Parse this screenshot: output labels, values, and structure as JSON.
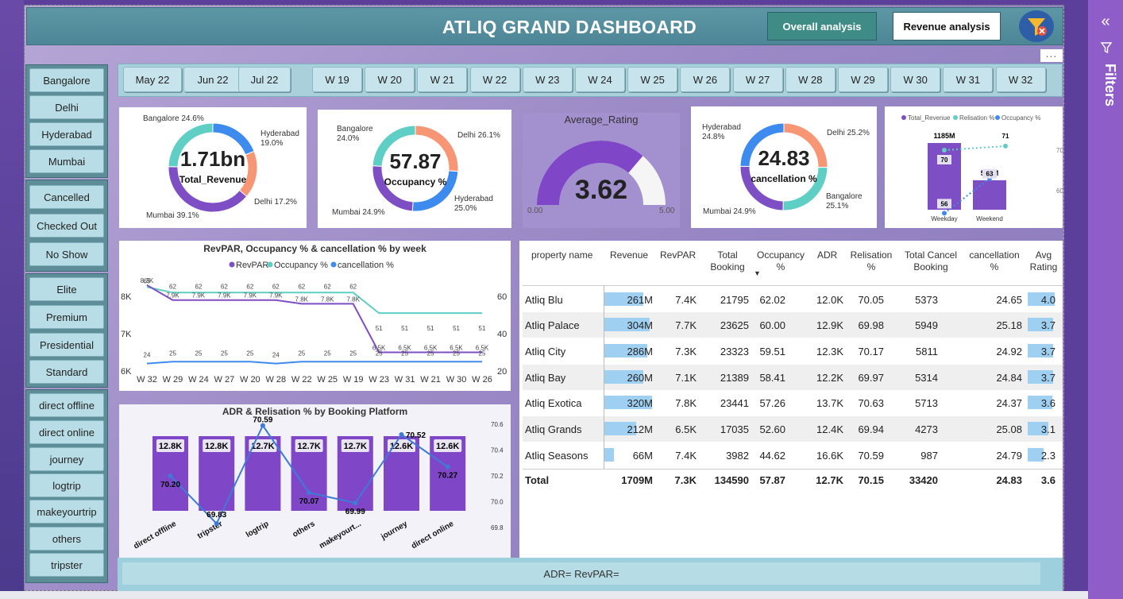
{
  "header": {
    "title": "ATLIQ GRAND DASHBOARD",
    "btn_overall": "Overall analysis",
    "btn_revenue": "Revenue analysis"
  },
  "filters_pane": {
    "label": "Filters",
    "chevron": "«"
  },
  "more_dots": "...",
  "slicers": {
    "cities": [
      "Bangalore",
      "Delhi",
      "Hyderabad",
      "Mumbai"
    ],
    "status": [
      "Cancelled",
      "Checked Out",
      "No Show"
    ],
    "room_class": [
      "Elite",
      "Premium",
      "Presidential",
      "Standard"
    ],
    "platforms": [
      "direct offline",
      "direct online",
      "journey",
      "logtrip",
      "makeyourtrip",
      "others",
      "tripster"
    ],
    "months": [
      "May 22",
      "Jun 22",
      "Jul 22"
    ],
    "weeks": [
      "W 19",
      "W 20",
      "W 21",
      "W 22",
      "W 23",
      "W 24",
      "W 25",
      "W 26",
      "W 27",
      "W 28",
      "W 29",
      "W 30",
      "W 31",
      "W 32"
    ]
  },
  "kpi_revenue": {
    "value": "1.71bn",
    "label": "Total_Revenue",
    "segments": [
      {
        "name": "Bangalore",
        "pct": 24.6,
        "color": "#5fcfc5",
        "text": "Bangalore 24.6%"
      },
      {
        "name": "Hyderabad",
        "pct": 19.0,
        "color": "#3e8bef",
        "text": "Hyderabad 19.0%"
      },
      {
        "name": "Delhi",
        "pct": 17.2,
        "color": "#f79675",
        "text": "Delhi 17.2%"
      },
      {
        "name": "Mumbai",
        "pct": 39.1,
        "color": "#7e4fc4",
        "text": "Mumbai 39.1%"
      }
    ]
  },
  "kpi_occupancy": {
    "value": "57.87",
    "label": "Occupancy %",
    "segments": [
      {
        "name": "Delhi",
        "pct": 26.1,
        "color": "#f79675",
        "text": "Delhi 26.1%"
      },
      {
        "name": "Hyderabad",
        "pct": 25.0,
        "color": "#3e8bef",
        "text": "Hyderabad 25.0%"
      },
      {
        "name": "Mumbai",
        "pct": 24.9,
        "color": "#7e4fc4",
        "text": "Mumbai 24.9%"
      },
      {
        "name": "Bangalore",
        "pct": 24.0,
        "color": "#5fcfc5",
        "text": "Bangalore 24.0%"
      }
    ]
  },
  "kpi_rating": {
    "title": "Average_Rating",
    "value": "3.62",
    "min": "0.00",
    "max": "5.00",
    "rating": 3.62,
    "scale_max": 5
  },
  "kpi_cancellation": {
    "value": "24.83",
    "label": "cancellation %",
    "segments": [
      {
        "name": "Delhi",
        "pct": 25.2,
        "color": "#f79675",
        "text": "Delhi 25.2%"
      },
      {
        "name": "Bangalore",
        "pct": 25.1,
        "color": "#5fcfc5",
        "text": "Bangalore 25.1%"
      },
      {
        "name": "Mumbai",
        "pct": 24.9,
        "color": "#7e4fc4",
        "text": "Mumbai 24.9%"
      },
      {
        "name": "Hyderabad",
        "pct": 24.8,
        "color": "#3e8bef",
        "text": "Hyderabad 24.8%"
      }
    ]
  },
  "weekday_chart": {
    "legend": [
      "Total_Revenue",
      "Relisation %",
      "Occupancy %"
    ],
    "categories": [
      "Weekday",
      "Weekend"
    ],
    "revenue_labels": [
      "1185M",
      "524M"
    ],
    "revenue": [
      1185,
      524
    ],
    "relisation": [
      70,
      71
    ],
    "occupancy": [
      56,
      63
    ],
    "y2_ticks": [
      "70",
      "60"
    ]
  },
  "week_chart": {
    "title": "RevPAR, Occupancy % & cancellation % by week",
    "legend": [
      "RevPAR",
      "Occupancy %",
      "cancellation %"
    ],
    "weeks": [
      "W 32",
      "W 29",
      "W 24",
      "W 27",
      "W 20",
      "W 28",
      "W 22",
      "W 25",
      "W 19",
      "W 23",
      "W 31",
      "W 21",
      "W 30",
      "W 26"
    ],
    "revpar": [
      8300,
      7900,
      7900,
      7900,
      7900,
      7900,
      7800,
      7800,
      7800,
      6500,
      6500,
      6500,
      6500,
      6500
    ],
    "revpar_labels": [
      "8.3K",
      "7.9K",
      "7.9K",
      "7.9K",
      "7.9K",
      "7.9K",
      "7.8K",
      "7.8K",
      "7.8K",
      "6.5K",
      "6.5K",
      "6.5K",
      "6.5K",
      "6.5K"
    ],
    "occupancy": [
      65,
      62,
      62,
      62,
      62,
      62,
      62,
      62,
      62,
      51,
      51,
      51,
      51,
      51
    ],
    "occupancy_labels": [
      "65",
      "62",
      "62",
      "62",
      "62",
      "62",
      "62",
      "62",
      "62",
      "51",
      "51",
      "51",
      "51",
      "51"
    ],
    "cancellation": [
      24,
      25,
      25,
      25,
      25,
      24,
      25,
      25,
      25,
      25,
      25,
      25,
      25,
      25
    ],
    "cancellation_labels": [
      "24",
      "25",
      "25",
      "25",
      "25",
      "24",
      "25",
      "25",
      "25",
      "25",
      "25",
      "25",
      "25",
      "25"
    ],
    "y_left": [
      "8K",
      "7K",
      "6K"
    ],
    "y_right": [
      "60",
      "40",
      "20"
    ]
  },
  "adr_chart": {
    "title": "ADR & Relisation % by Booking Platform",
    "categories": [
      "direct offline",
      "tripster",
      "logtrip",
      "others",
      "makeyourt...",
      "journey",
      "direct online"
    ],
    "adr_labels": [
      "12.8K",
      "12.8K",
      "12.7K",
      "12.7K",
      "12.7K",
      "12.6K",
      "12.6K"
    ],
    "relisation": [
      70.2,
      69.83,
      70.59,
      70.07,
      69.99,
      70.52,
      70.27
    ],
    "relisation_labels": [
      "70.20",
      "69.83",
      "70.59",
      "70.07",
      "69.99",
      "70.52",
      "70.27"
    ],
    "y_right": [
      "70.6",
      "70.4",
      "70.2",
      "70.0",
      "69.8"
    ]
  },
  "table": {
    "headers": [
      "property name",
      "Revenue",
      "RevPAR",
      "Total Booking",
      "Occupancy %",
      "ADR",
      "Relisation %",
      "Total Cancel Booking",
      "cancellation %",
      "Avg Rating"
    ],
    "rows": [
      [
        "Atliq Blu",
        "261M",
        "7.4K",
        "21795",
        "62.02",
        "12.0K",
        "70.05",
        "5373",
        "24.65",
        "4.0"
      ],
      [
        "Atliq Palace",
        "304M",
        "7.7K",
        "23625",
        "60.00",
        "12.9K",
        "69.98",
        "5949",
        "25.18",
        "3.7"
      ],
      [
        "Atliq City",
        "286M",
        "7.3K",
        "23323",
        "59.51",
        "12.3K",
        "70.17",
        "5811",
        "24.92",
        "3.7"
      ],
      [
        "Atliq Bay",
        "260M",
        "7.1K",
        "21389",
        "58.41",
        "12.2K",
        "69.97",
        "5314",
        "24.84",
        "3.7"
      ],
      [
        "Atliq Exotica",
        "320M",
        "7.8K",
        "23441",
        "57.26",
        "13.7K",
        "70.63",
        "5713",
        "24.37",
        "3.6"
      ],
      [
        "Atliq Grands",
        "212M",
        "6.5K",
        "17035",
        "52.60",
        "12.4K",
        "69.94",
        "4273",
        "25.08",
        "3.1"
      ],
      [
        "Atliq Seasons",
        "66M",
        "7.4K",
        "3982",
        "44.62",
        "16.6K",
        "70.59",
        "987",
        "24.79",
        "2.3"
      ]
    ],
    "revenue_values": [
      261,
      304,
      286,
      260,
      320,
      212,
      66
    ],
    "rating_values": [
      4.0,
      3.7,
      3.7,
      3.7,
      3.6,
      3.1,
      2.3
    ],
    "total": [
      "Total",
      "1709M",
      "7.3K",
      "134590",
      "57.87",
      "12.7K",
      "70.15",
      "33420",
      "24.83",
      "3.6"
    ]
  },
  "bottom_text": "ADR=  RevPAR="
}
